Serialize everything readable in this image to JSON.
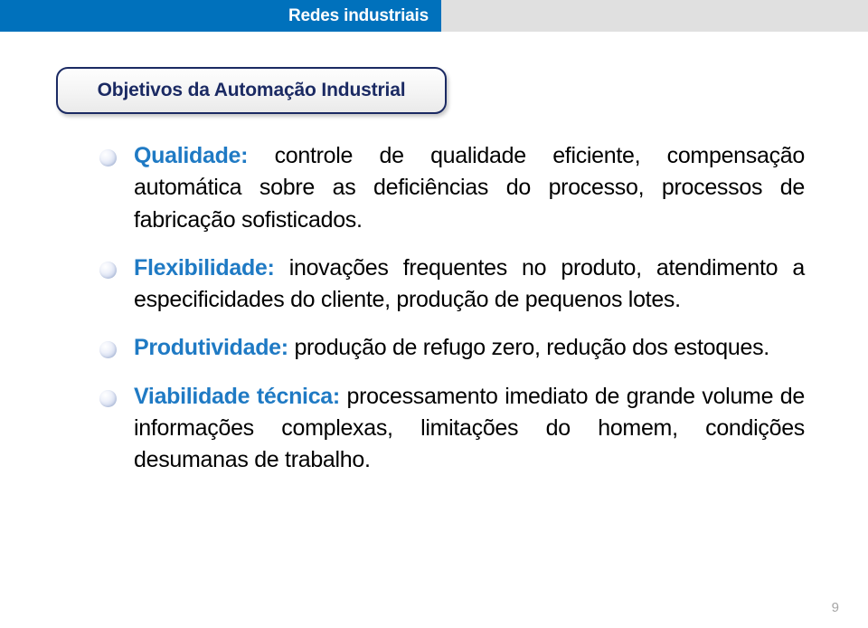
{
  "header": {
    "title": "Redes industriais",
    "blue_color": "#0071bc",
    "gray_color": "#e0e0e0",
    "title_color": "#ffffff"
  },
  "section": {
    "title": "Objetivos da Automação Industrial",
    "border_color": "#1b2a63",
    "text_color": "#1b2a63"
  },
  "content": {
    "accent_color": "#1f7ac4",
    "body_color": "#000000",
    "bullet_icon": "sphere-bullet",
    "bullets": [
      {
        "lead": "Qualidade:",
        "body": " controle de qualidade eficiente, compensação automática sobre as deficiências do processo, processos de fabricação sofisticados."
      },
      {
        "lead": "Flexibilidade:",
        "body": " inovações frequentes no produto, atendimento a especificidades do cliente, produção de pequenos lotes."
      },
      {
        "lead": "Produtividade:",
        "body": " produção de refugo zero, redução dos estoques."
      },
      {
        "lead": "Viabilidade técnica:",
        "body": " processamento imediato de grande volume de informações complexas, limitações do homem, condições desumanas de trabalho."
      }
    ]
  },
  "footer": {
    "page_number": "9",
    "color": "#a6a6a6"
  }
}
